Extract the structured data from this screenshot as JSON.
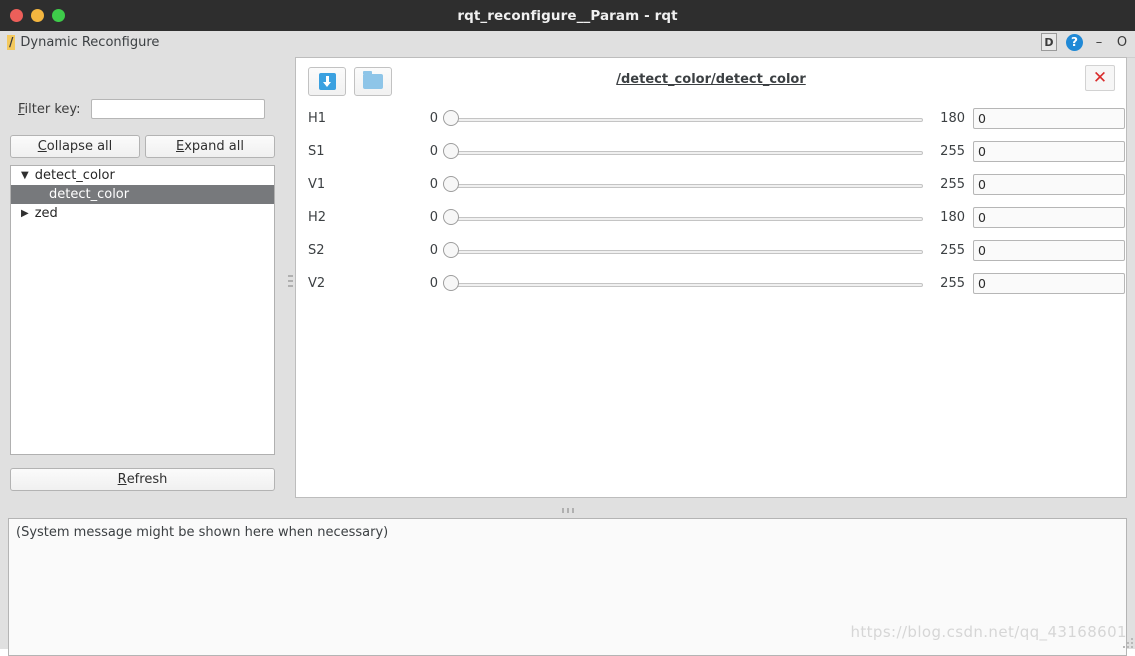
{
  "window": {
    "title": "rqt_reconfigure__Param - rqt"
  },
  "plugin_header": {
    "badge": "/",
    "title": "Dynamic Reconfigure",
    "dock_label": "D",
    "help_label": "?",
    "minimize_label": "–",
    "float_label": "O"
  },
  "sidebar": {
    "filter_label_prefix": "F",
    "filter_label_rest": "ilter key:",
    "filter_value": "",
    "filter_placeholder": "",
    "collapse_prefix": "C",
    "collapse_rest": "ollapse all",
    "expand_prefix": "E",
    "expand_rest": "xpand all",
    "refresh_prefix": "R",
    "refresh_rest": "efresh",
    "tree": [
      {
        "label": "detect_color",
        "arrow": "▼",
        "level": 0,
        "selected": false
      },
      {
        "label": "detect_color",
        "arrow": "",
        "level": 1,
        "selected": true
      },
      {
        "label": "zed",
        "arrow": "▶",
        "level": 0,
        "selected": false
      }
    ]
  },
  "params_panel": {
    "node_path": "/detect_color/detect_color",
    "save_icon": "save-down-arrow-icon",
    "open_icon": "folder-icon",
    "close_label": "✕",
    "rows": [
      {
        "name": "H1",
        "min": "0",
        "max": "180",
        "value": "0"
      },
      {
        "name": "S1",
        "min": "0",
        "max": "255",
        "value": "0"
      },
      {
        "name": "V1",
        "min": "0",
        "max": "255",
        "value": "0"
      },
      {
        "name": "H2",
        "min": "0",
        "max": "180",
        "value": "0"
      },
      {
        "name": "S2",
        "min": "0",
        "max": "255",
        "value": "0"
      },
      {
        "name": "V2",
        "min": "0",
        "max": "255",
        "value": "0"
      }
    ]
  },
  "console": {
    "message": "(System message might be shown here when necessary)"
  },
  "watermark": {
    "text": "https://blog.csdn.net/qq_43168601"
  },
  "colors": {
    "accent_blue": "#3ba1e0",
    "help_blue": "#2089d6",
    "close_red": "#d92b2b",
    "selection_gray": "#77797c",
    "chrome_gray": "#e0e0e0",
    "titlebar_dark": "#2e2e2e"
  }
}
